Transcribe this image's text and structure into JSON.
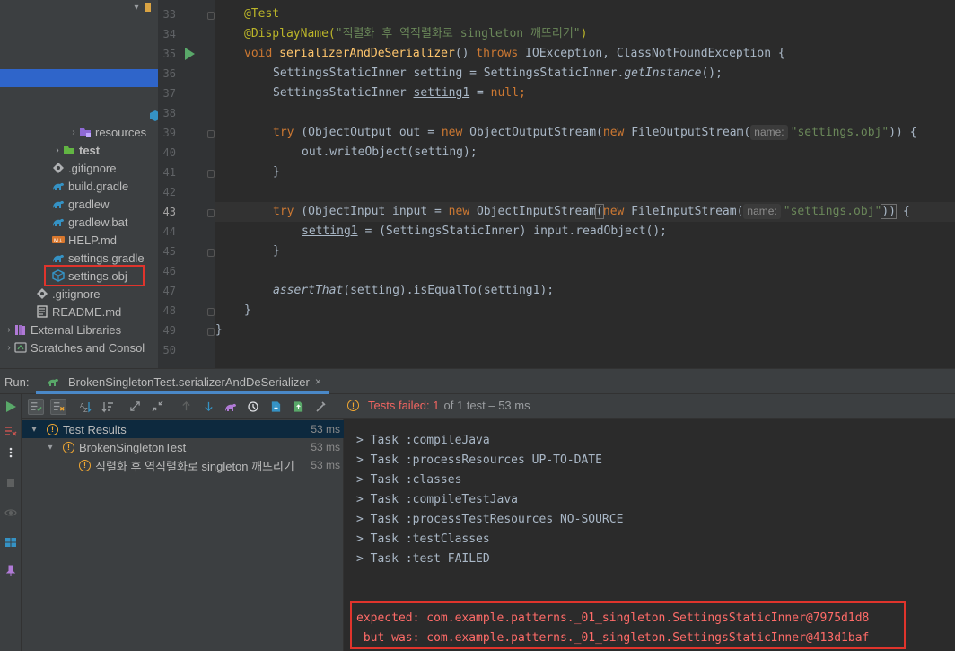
{
  "project_tree": {
    "items": [
      {
        "label": "resources",
        "icon": "folder-icon"
      },
      {
        "label": "test",
        "icon": "folder-icon"
      },
      {
        "label": ".gitignore",
        "icon": "gitignore-icon"
      },
      {
        "label": "build.gradle",
        "icon": "gradle-icon"
      },
      {
        "label": "gradlew",
        "icon": "gradle-icon"
      },
      {
        "label": "gradlew.bat",
        "icon": "gradle-icon"
      },
      {
        "label": "HELP.md",
        "icon": "markdown-icon"
      },
      {
        "label": "settings.gradle",
        "icon": "gradle-icon"
      },
      {
        "label": "settings.obj",
        "icon": "file-icon"
      },
      {
        "label": ".gitignore",
        "icon": "gitignore-icon"
      },
      {
        "label": "README.md",
        "icon": "markdown-icon"
      },
      {
        "label": "External Libraries",
        "icon": "library-icon"
      },
      {
        "label": "Scratches and Consol",
        "icon": "scratches-icon"
      }
    ]
  },
  "editor": {
    "line_numbers": [
      "33",
      "34",
      "35",
      "36",
      "37",
      "38",
      "39",
      "40",
      "41",
      "42",
      "43",
      "44",
      "45",
      "46",
      "47",
      "48",
      "49",
      "50"
    ],
    "current_line": "43",
    "code": {
      "l33_ann": "@Test",
      "l34_ann": "@DisplayName(",
      "l34_str": "\"직렬화 후 역직렬화로 singleton 깨뜨리기\"",
      "l34_end": ")",
      "l35_kw1": "void",
      "l35_fn": "serializerAndDeSerializer",
      "l35_mid": "() ",
      "l35_kw2": "throws",
      "l35_rest": " IOException, ClassNotFoundException {",
      "l36_a": "SettingsStaticInner setting = SettingsStaticInner.",
      "l36_b": "getInstance",
      "l36_c": "();",
      "l37_a": "SettingsStaticInner ",
      "l37_b": "setting1",
      "l37_c": " = ",
      "l37_d": "null",
      "l37_e": ";",
      "l39_try": "try",
      "l39_a": " (ObjectOutput out = ",
      "l39_new1": "new",
      "l39_b": " ObjectOutputStream(",
      "l39_new2": "new",
      "l39_c": " FileOutputStream(",
      "l39_hint": "name:",
      "l39_str": "\"settings.obj\"",
      "l39_d": ")) {",
      "l40": "out.writeObject(setting);",
      "l41": "}",
      "l43_try": "try",
      "l43_a": " (ObjectInput input = ",
      "l43_new1": "new",
      "l43_b": " ObjectInputStream",
      "l43_paren": "(",
      "l43_new2": "new",
      "l43_c": " FileInputStream(",
      "l43_hint": "name:",
      "l43_str": "\"settings.obj\"",
      "l43_d": "))",
      "l43_e": " {",
      "l44_a": "setting1",
      "l44_b": " = (SettingsStaticInner) input.readObject();",
      "l45": "}",
      "l47_a": "assertThat",
      "l47_b": "(setting).isEqualTo(",
      "l47_c": "setting1",
      "l47_d": ");",
      "l48": "}",
      "l49": "}"
    }
  },
  "run_panel": {
    "label": "Run:",
    "tab_title": "BrokenSingletonTest.serializerAndDeSerializer",
    "tab_close": "×",
    "status_failed": "Tests failed: 1",
    "status_rest": "of 1 test – 53 ms",
    "results": [
      {
        "label": "Test Results",
        "time": "53 ms"
      },
      {
        "label": "BrokenSingletonTest",
        "time": "53 ms"
      },
      {
        "label": "직렬화 후 역직렬화로 singleton 깨뜨리기",
        "time": "53 ms"
      }
    ],
    "console": [
      "> Task :compileJava",
      "> Task :processResources UP-TO-DATE",
      "> Task :classes",
      "> Task :compileTestJava",
      "> Task :processTestResources NO-SOURCE",
      "> Task :testClasses",
      "> Task :test FAILED"
    ],
    "error_expected": "expected: com.example.patterns._01_singleton.SettingsStaticInner@7975d1d8",
    "error_actual": " but was: com.example.patterns._01_singleton.SettingsStaticInner@413d1baf"
  },
  "colors": {
    "accent": "#2f65ca",
    "error": "#ff6b68",
    "highlight_box": "#e0342c",
    "run_green": "#59a869",
    "warning": "#f0a732"
  }
}
